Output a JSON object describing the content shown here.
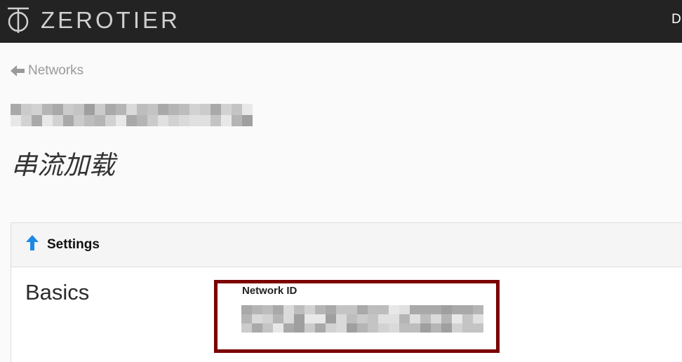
{
  "header": {
    "brand_text": "ZEROTIER",
    "right_text": "D"
  },
  "nav": {
    "back_label": "Networks"
  },
  "network": {
    "title": "串流加载"
  },
  "settings": {
    "header_label": "Settings",
    "section_title": "Basics",
    "network_id_label": "Network ID"
  },
  "colors": {
    "topbar": "#232323",
    "accent_arrow": "#1e88e5",
    "highlight_border": "#7b0000",
    "page_background": "#fafafa"
  },
  "icons": {
    "logo": "zerotier-logo-icon",
    "back": "arrow-left-icon",
    "collapse": "arrow-up-icon"
  }
}
